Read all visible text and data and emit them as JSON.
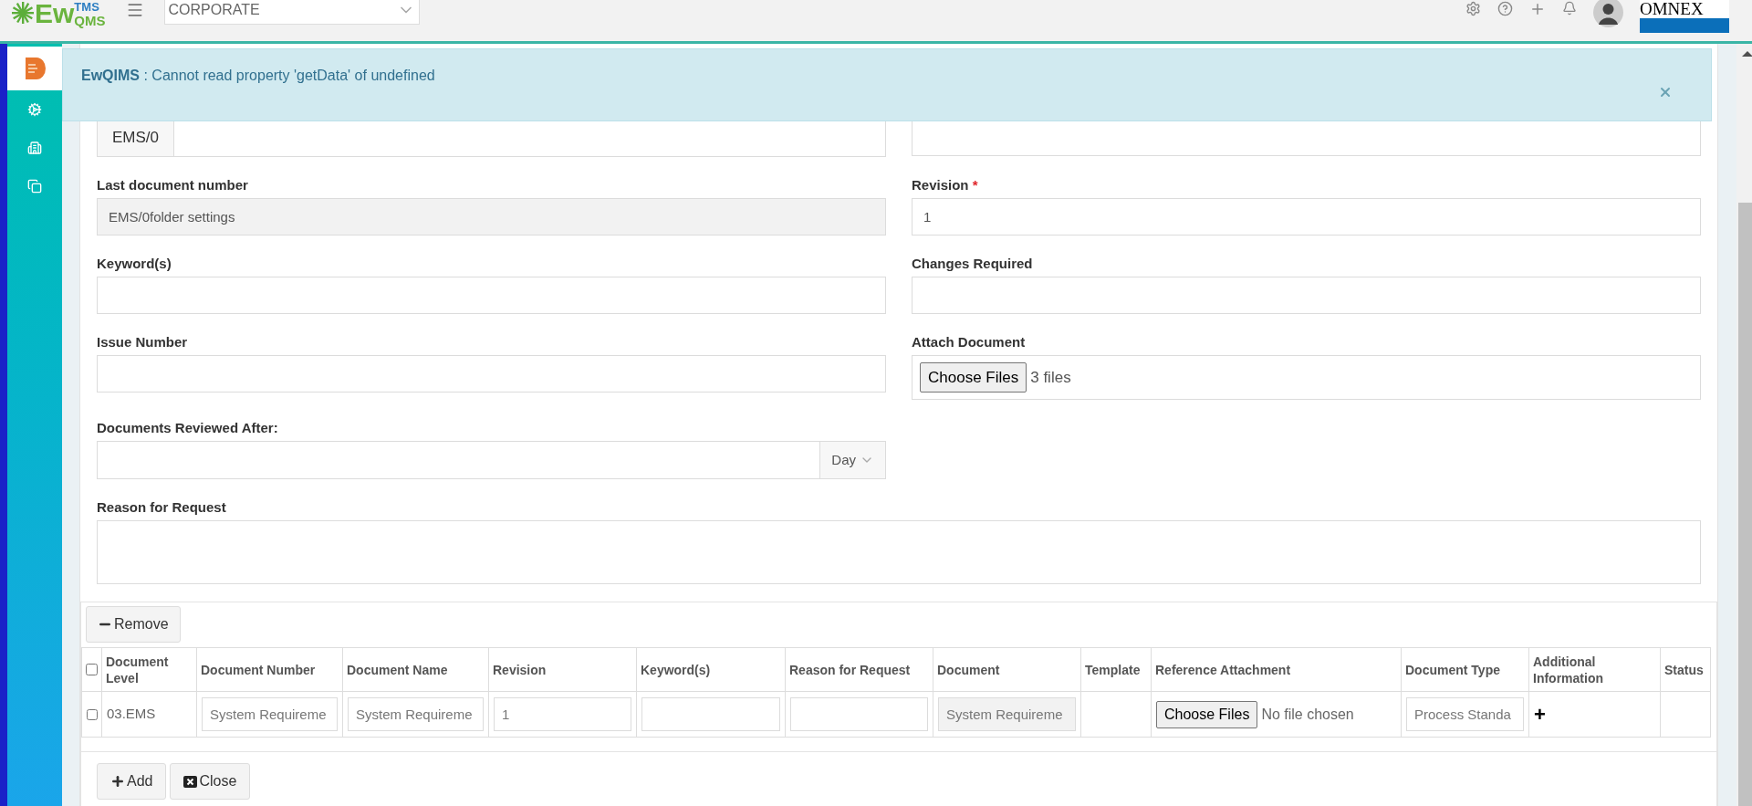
{
  "header": {
    "logo": {
      "main": "Ew",
      "sup": "TMS",
      "sub": "QMS"
    },
    "org_select": {
      "value": "CORPORATE"
    },
    "brand": "OMNEX"
  },
  "sidebar": {
    "items": [
      {
        "selected": true
      },
      {
        "selected": false
      },
      {
        "selected": false
      },
      {
        "selected": false
      }
    ]
  },
  "alert": {
    "source": "EwQIMS",
    "message": " : Cannot read property 'getData' of undefined"
  },
  "form": {
    "rows": [
      [
        {
          "kind": "prefix",
          "prefix": "EMS/0"
        },
        {
          "kind": "text"
        }
      ],
      [
        {
          "kind": "readonly",
          "label": "Last document number",
          "value": "EMS/0folder settings"
        },
        {
          "kind": "text",
          "label": "Revision",
          "required_mark": "*",
          "value": "1"
        }
      ],
      [
        {
          "kind": "text",
          "label": "Keyword(s)"
        },
        {
          "kind": "text",
          "label": "Changes Required"
        }
      ],
      [
        {
          "kind": "text",
          "label": "Issue Number"
        },
        {
          "kind": "file",
          "label": "Attach Document",
          "button": "Choose Files",
          "status": "3 files"
        }
      ],
      [
        {
          "kind": "select-addon",
          "label": "Documents Reviewed After:",
          "addon": "Day"
        }
      ],
      [
        {
          "kind": "textarea",
          "label": "Reason for Request"
        }
      ]
    ]
  },
  "table": {
    "remove_button": "Remove",
    "header_checked": false,
    "columns": [
      "Document Level",
      "Document Number",
      "Document Name",
      "Revision",
      "Keyword(s)",
      "Reason for Request",
      "Document",
      "Template",
      "Reference Attachment",
      "Document Type",
      "Additional Information",
      "Status"
    ],
    "rows": [
      {
        "checked": false,
        "cells": [
          {
            "kind": "text",
            "value": "03.EMS"
          },
          {
            "kind": "input",
            "value": "System Requireme"
          },
          {
            "kind": "input",
            "value": "System Requireme"
          },
          {
            "kind": "input",
            "value": "1"
          },
          {
            "kind": "input"
          },
          {
            "kind": "input"
          },
          {
            "kind": "readonly",
            "value": "System Requireme"
          },
          {
            "kind": "empty"
          },
          {
            "kind": "file",
            "button": "Choose Files",
            "status": "No file chosen"
          },
          {
            "kind": "input",
            "value": "Process Standa"
          },
          {
            "kind": "add",
            "symbol": "+"
          },
          {
            "kind": "empty"
          }
        ]
      }
    ],
    "footer_buttons": [
      {
        "kind": "add",
        "label": "Add"
      },
      {
        "kind": "close",
        "label": "Close"
      }
    ]
  }
}
